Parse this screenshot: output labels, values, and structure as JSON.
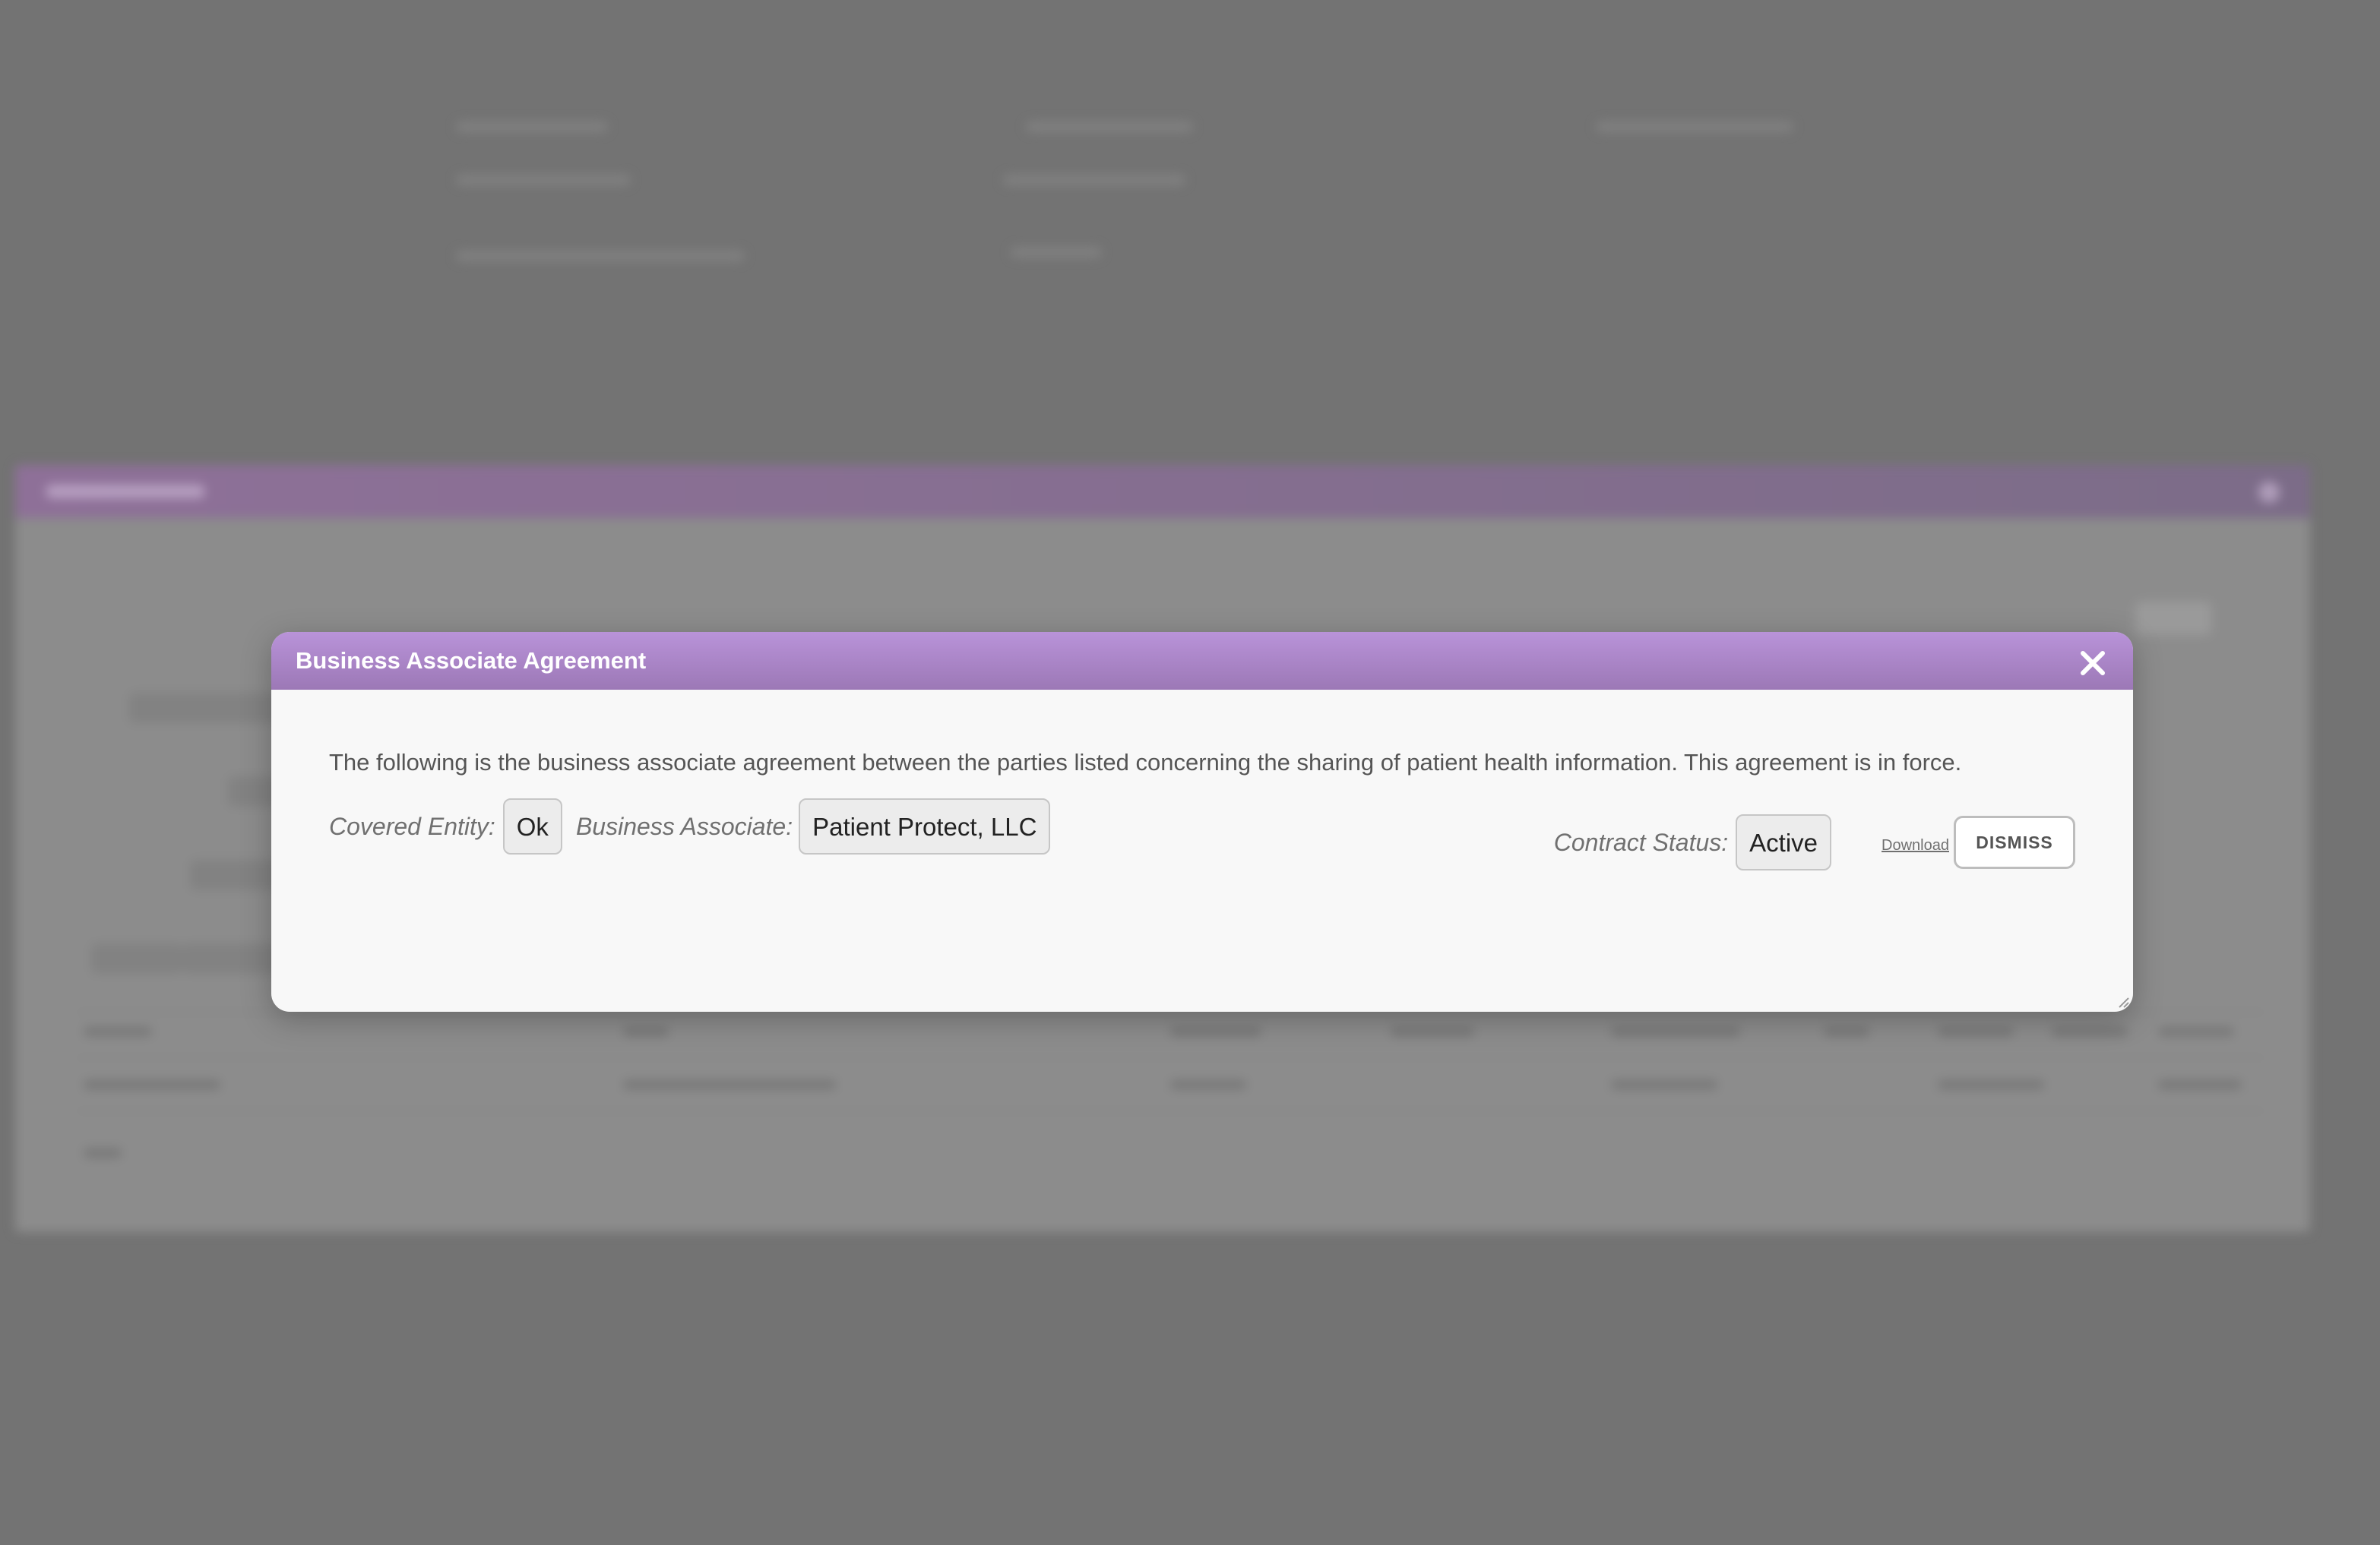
{
  "modal": {
    "title": "Business Associate Agreement",
    "close_icon": "close-icon",
    "description": "The following is the business associate agreement between the parties listed concerning the sharing of patient health information. This agreement is in force.",
    "covered_entity": {
      "label": "Covered Entity:",
      "value": "Ok"
    },
    "business_associate": {
      "label": "Business Associate:",
      "value": "Patient Protect, LLC"
    },
    "contract_status": {
      "label": "Contract Status:",
      "value": "Active"
    },
    "download_label": "Download",
    "dismiss_label": "DISMISS",
    "resize_icon": "resize-handle-icon"
  },
  "colors": {
    "header_gradient_top": "#b993d9",
    "header_gradient_bottom": "#9c78b6",
    "overlay": "#737373",
    "modal_bg": "#f8f8f8"
  }
}
